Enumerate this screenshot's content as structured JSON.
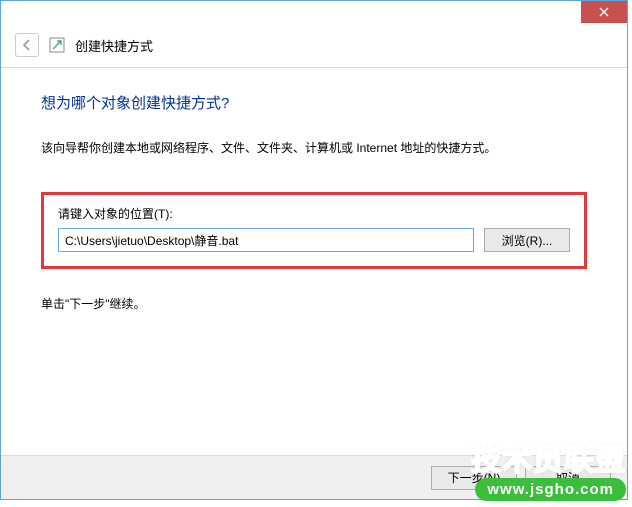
{
  "window": {
    "title": "创建快捷方式"
  },
  "wizard": {
    "heading": "想为哪个对象创建快捷方式?",
    "description": "该向导帮你创建本地或网络程序、文件、文件夹、计算机或 Internet 地址的快捷方式。",
    "location_label": "请键入对象的位置(T):",
    "path_value": "C:\\Users\\jietuo\\Desktop\\静音.bat",
    "browse_label": "浏览(R)...",
    "continue_hint": "单击\"下一步\"继续。"
  },
  "footer": {
    "next_label": "下一步(N)",
    "cancel_label": "取消"
  },
  "watermark": {
    "brand": "技术员联盟",
    "url": "www.jsgho.com"
  }
}
